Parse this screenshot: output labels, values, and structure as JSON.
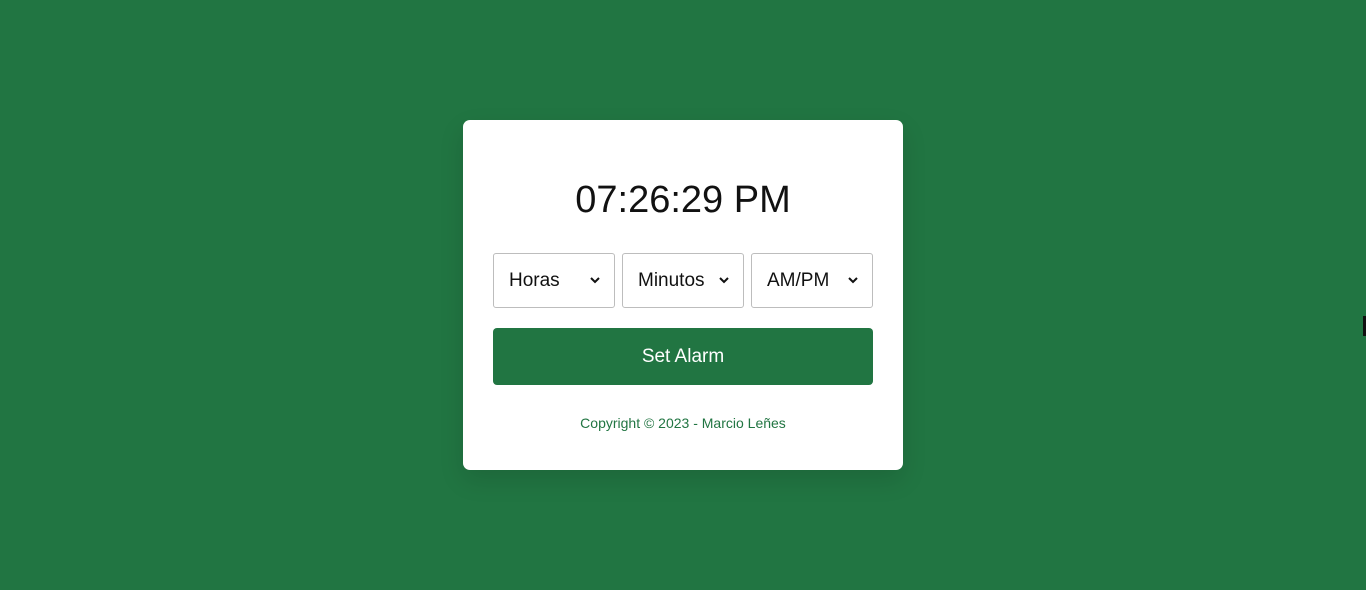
{
  "clock": {
    "time": "07:26:29 PM"
  },
  "alarm": {
    "hour_select": {
      "value": "Horas",
      "icon": "chevron-down-icon"
    },
    "minute_select": {
      "value": "Minutos",
      "icon": "chevron-down-icon"
    },
    "ampm_select": {
      "value": "AM/PM",
      "icon": "chevron-down-icon"
    },
    "set_label": "Set Alarm"
  },
  "footer": {
    "copyright": "Copyright © 2023 - Marcio Leñes"
  },
  "colors": {
    "background": "#217542",
    "card": "#ffffff",
    "button": "#217542",
    "button_text": "#ffffff",
    "footer_text": "#217542"
  }
}
